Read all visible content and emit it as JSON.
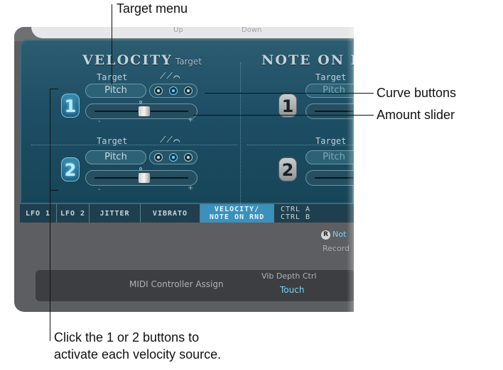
{
  "callouts": {
    "target_menu": "Target menu",
    "curve_buttons": "Curve buttons",
    "amount_slider": "Amount slider",
    "number_buttons_line1": "Click the 1 or 2 buttons to",
    "number_buttons_line2": "activate each velocity source."
  },
  "header": {
    "up": "Up",
    "down": "Down"
  },
  "velocity": {
    "title": "VELOCITY",
    "subtitle": "Target",
    "sources": [
      {
        "number": "1",
        "target_label": "Target",
        "target_value": "Pitch",
        "active": true,
        "curve_selected": 1,
        "amount": 0.5,
        "min": "-",
        "max": "+"
      },
      {
        "number": "2",
        "target_label": "Target",
        "target_value": "Pitch",
        "active": true,
        "curve_selected": 1,
        "amount": 0.5,
        "min": "-",
        "max": "+"
      }
    ]
  },
  "note_on": {
    "title": "NOTE ON R",
    "sources": [
      {
        "number": "1",
        "target_label": "Target",
        "target_value": "Pitch"
      },
      {
        "number": "2",
        "target_label": "Target",
        "target_value": "Pitch"
      }
    ]
  },
  "tabs": [
    {
      "line1": "LFO 1",
      "line2": ""
    },
    {
      "line1": "LFO 2",
      "line2": ""
    },
    {
      "line1": "JITTER",
      "line2": ""
    },
    {
      "line1": "VIBRATO",
      "line2": ""
    },
    {
      "line1": "VELOCITY/",
      "line2": "NOTE ON RND"
    },
    {
      "line1": "CTRL A",
      "line2": "CTRL B"
    }
  ],
  "note_record": {
    "badge": "R",
    "label": "Not",
    "sub": "Record"
  },
  "bottom": {
    "midi_assign": "MIDI Controller Assign",
    "vib_depth_label": "Vib Depth Ctrl",
    "vib_depth_value": "Touch"
  },
  "colors": {
    "accent": "#3b90bc",
    "active_number": "#6fd0ff",
    "panel": "#1e4f66"
  }
}
